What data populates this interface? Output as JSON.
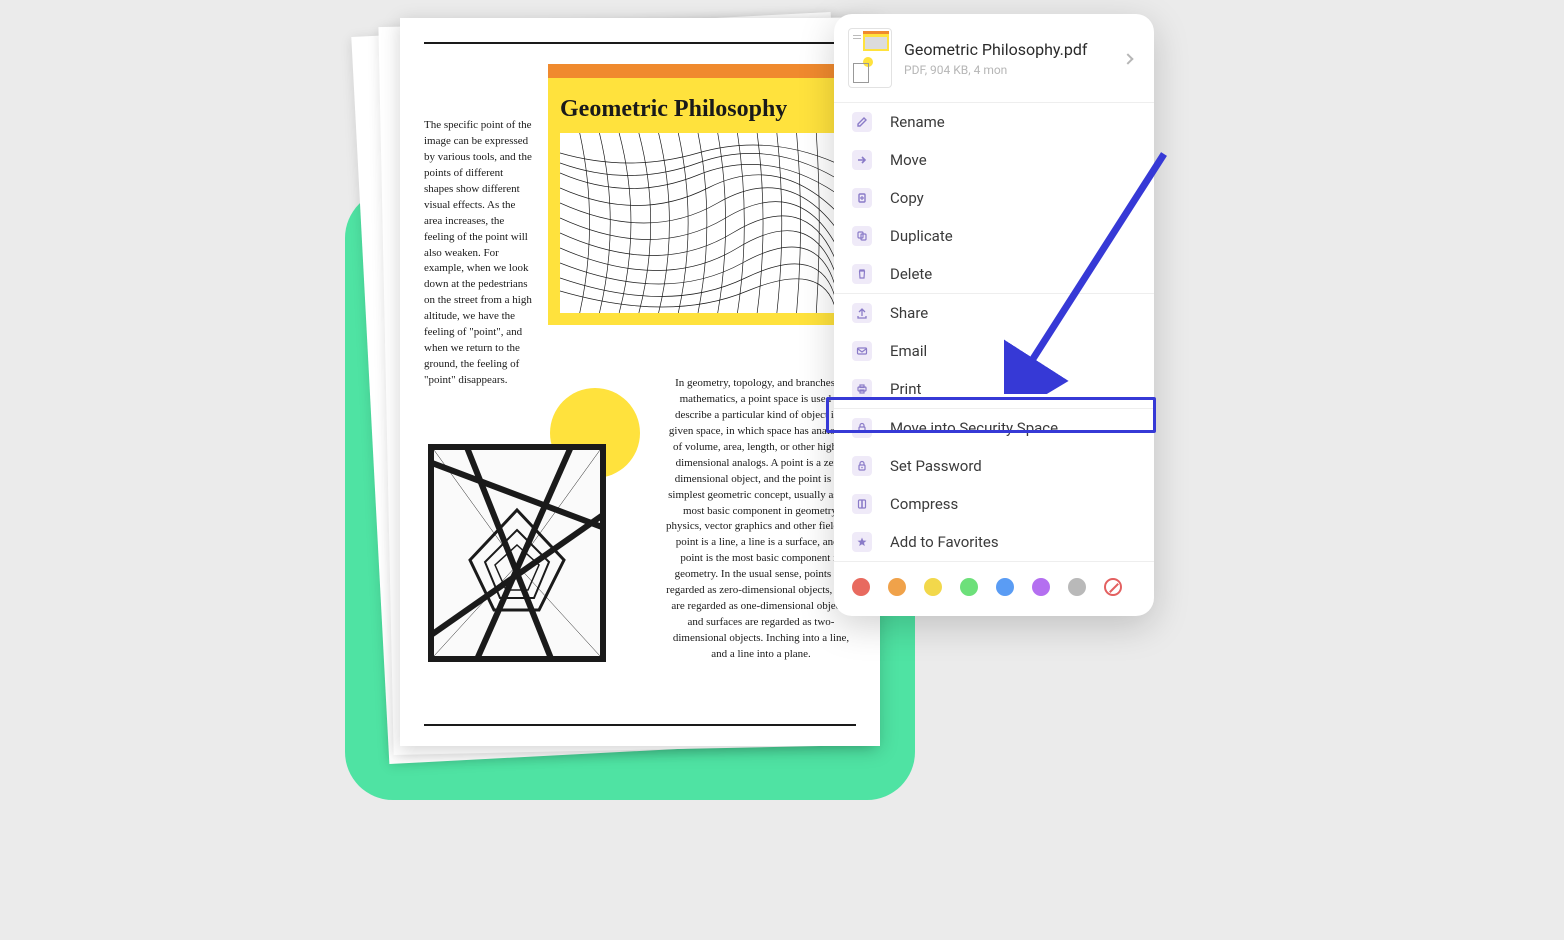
{
  "document": {
    "title": "Geometric Philosophy",
    "paragraph_left": "The specific point of the image can be expressed by various tools, and the points of different shapes show different visual effects. As the area increases, the feeling of the point will also weaken. For example, when we look down at the pedestrians on the street from a high altitude, we have the feeling of \"point\", and when we return to the ground, the feeling of \"point\" disappears.",
    "paragraph_right": "In geometry, topology, and branches of mathematics, a point space is used to describe a particular kind of object in a given space, in which space has analogies of volume, area, length, or other higher-dimensional analogs. A point is a zero-dimensional object, and the point is the simplest geometric concept, usually as the most basic component in geometry, physics, vector graphics and other fields. A point is a line, a line is a surface, and a point is the most basic component in geometry. In the usual sense, points are regarded as zero-dimensional objects, lines are regarded as one-dimensional objects, and surfaces are regarded as two-dimensional objects. Inching into a line, and a line into a plane."
  },
  "menu": {
    "file_name": "Geometric Philosophy.pdf",
    "file_meta": "PDF, 904 KB, 4 mon",
    "items_group1": [
      {
        "label": "Rename",
        "icon": "rename"
      },
      {
        "label": "Move",
        "icon": "move"
      },
      {
        "label": "Copy",
        "icon": "copy"
      },
      {
        "label": "Duplicate",
        "icon": "duplicate"
      },
      {
        "label": "Delete",
        "icon": "delete"
      }
    ],
    "items_group2": [
      {
        "label": "Share",
        "icon": "share"
      },
      {
        "label": "Email",
        "icon": "email"
      },
      {
        "label": "Print",
        "icon": "print"
      }
    ],
    "items_group3": [
      {
        "label": "Move into Security Space",
        "icon": "lock"
      },
      {
        "label": "Set Password",
        "icon": "key"
      },
      {
        "label": "Compress",
        "icon": "compress"
      },
      {
        "label": "Add to Favorites",
        "icon": "star"
      }
    ],
    "colors": [
      "#e86a5f",
      "#f0a24a",
      "#f2d84b",
      "#6de07a",
      "#5a9cf4",
      "#b46ff0",
      "#b9b9b9"
    ]
  }
}
